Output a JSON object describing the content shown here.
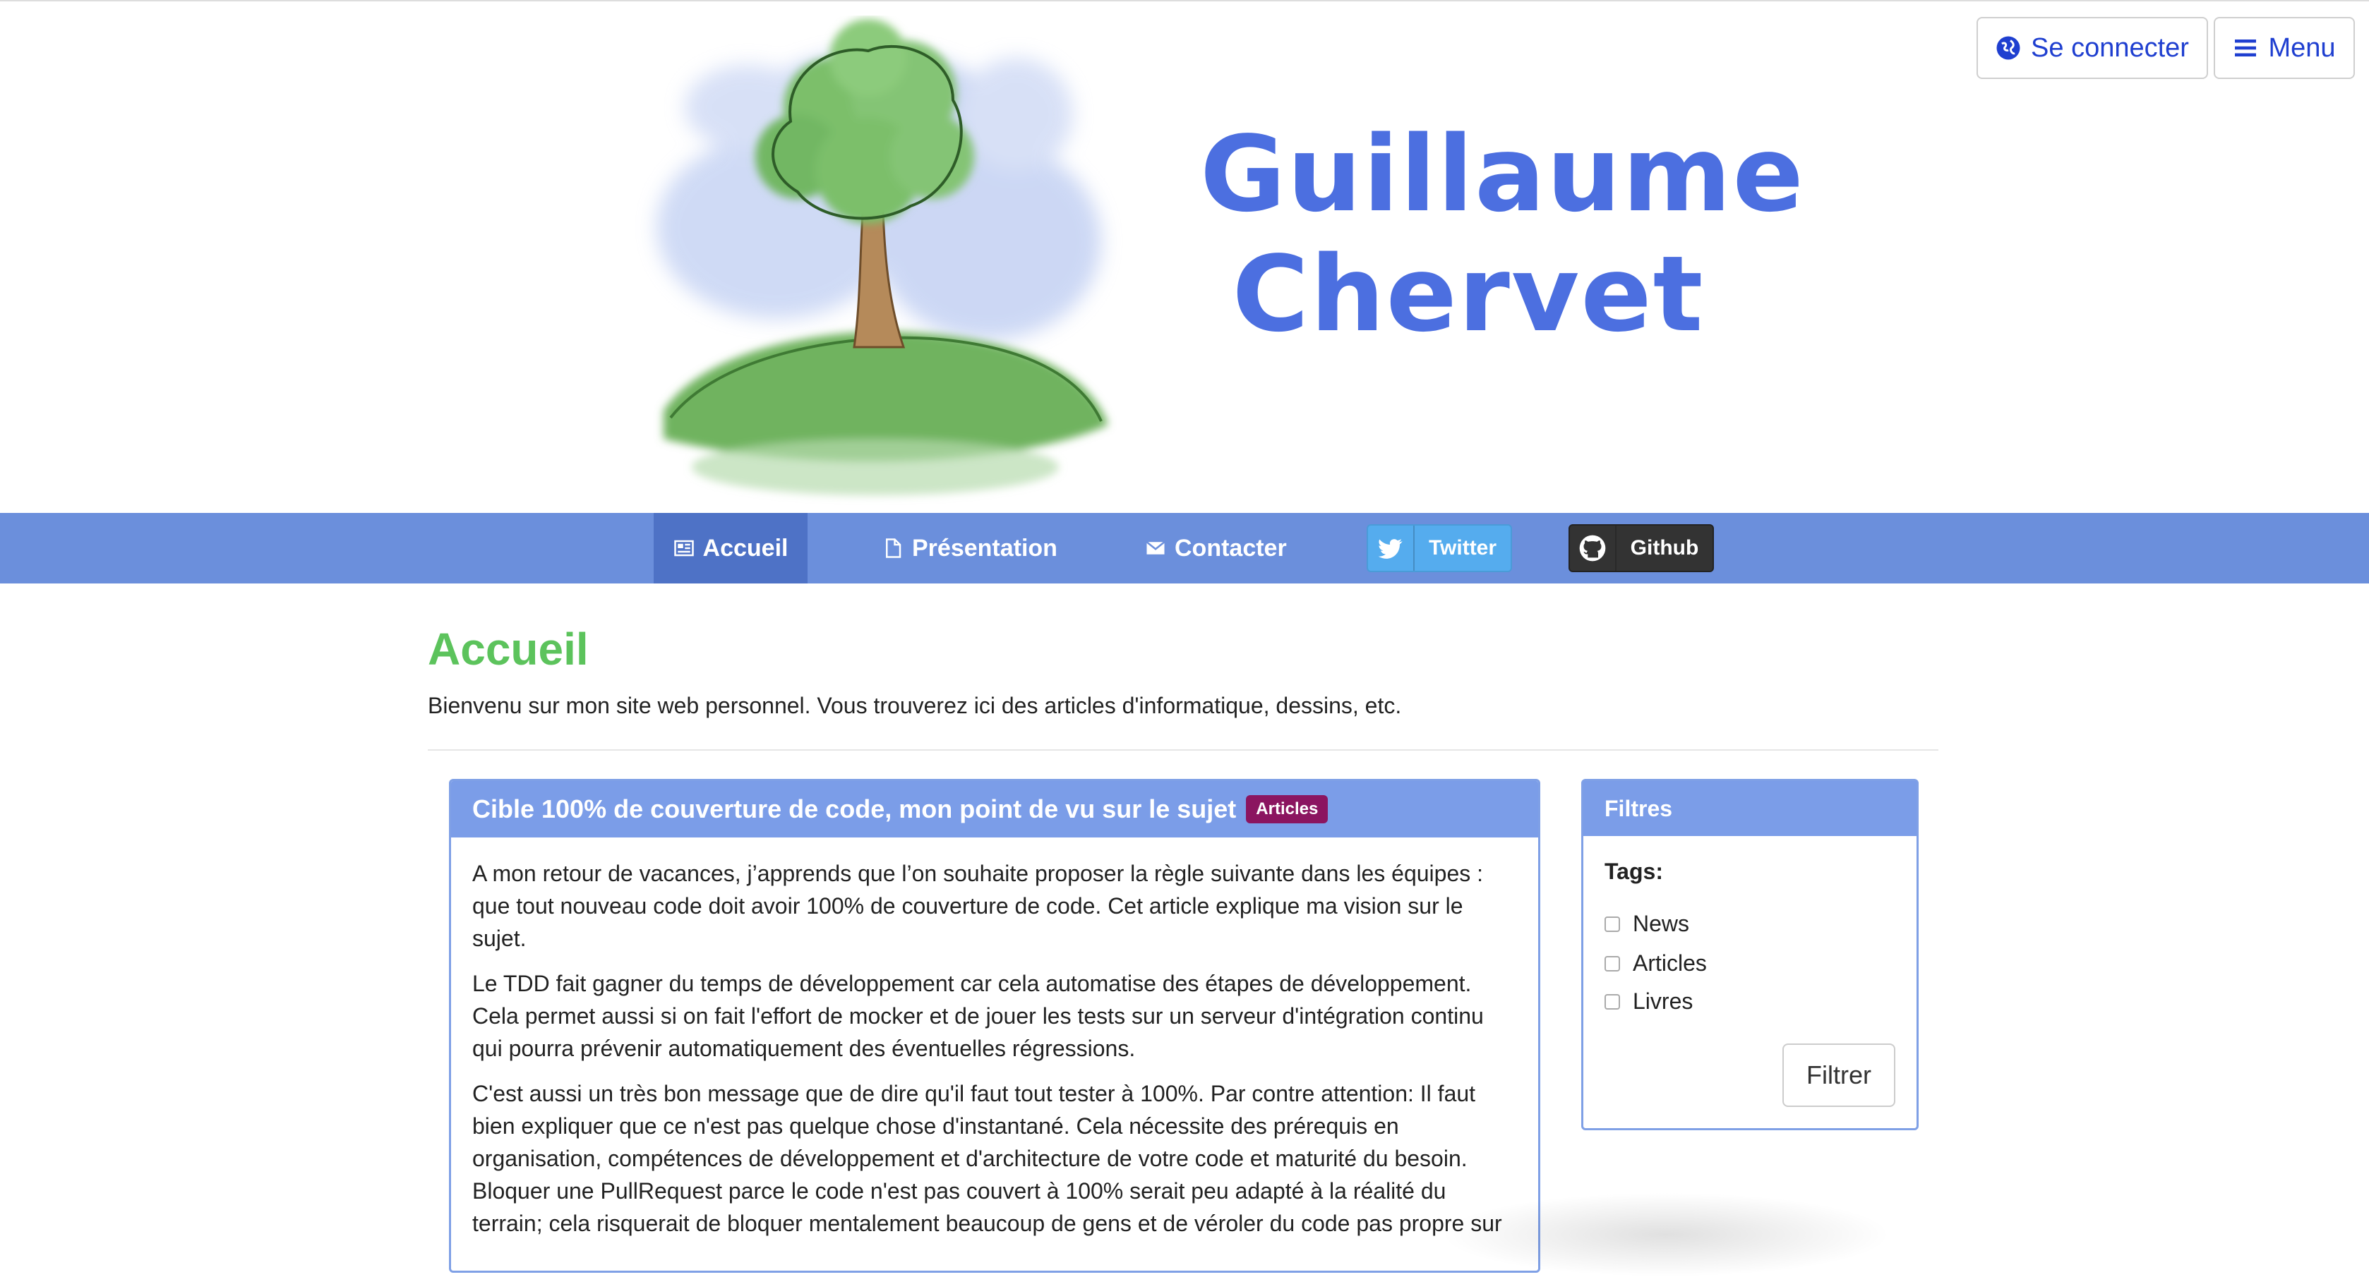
{
  "header": {
    "title_line1": "Guillaume",
    "title_line2": "Chervet",
    "login_label": "Se connecter",
    "menu_label": "Menu",
    "accent_color": "#4c6fe0"
  },
  "nav": {
    "home_label": "Accueil",
    "presentation_label": "Présentation",
    "contact_label": "Contacter",
    "twitter_label": "Twitter",
    "github_label": "Github",
    "bar_color": "#6b8fdc",
    "active_item": "Accueil"
  },
  "page": {
    "title": "Accueil",
    "intro": "Bienvenu sur mon site web personnel. Vous trouverez ici des articles d'informatique, dessins, etc.",
    "title_color": "#5cc35c"
  },
  "article": {
    "title": "Cible 100% de couverture de code, mon point de vu sur le sujet",
    "badge": "Articles",
    "paragraphs": [
      "A mon retour de vacances, j’apprends que l’on souhaite proposer la règle suivante dans les équipes : que tout nouveau code doit avoir 100% de couverture de code. Cet article explique ma vision sur le sujet.",
      "Le TDD fait gagner du temps de développement car cela automatise des étapes de développement. Cela permet aussi si on fait l'effort de mocker et de jouer les tests sur un serveur d'intégration continu qui pourra prévenir automatiquement des éventuelles régressions.",
      "C'est aussi un très bon message que de dire qu'il faut tout tester à 100%. Par contre attention: Il faut bien expliquer que ce n'est pas quelque chose d'instantané. Cela nécessite des prérequis en organisation, compétences de développement et d'architecture de votre code et maturité du besoin. Bloquer une PullRequest parce le code n'est pas couvert à 100% serait peu adapté à la réalité du terrain; cela risquerait de bloquer mentalement beaucoup de gens et de véroler du code pas propre sur"
    ]
  },
  "filters": {
    "title": "Filtres",
    "tags_label": "Tags:",
    "tags": [
      "News",
      "Articles",
      "Livres"
    ],
    "button_label": "Filtrer"
  }
}
